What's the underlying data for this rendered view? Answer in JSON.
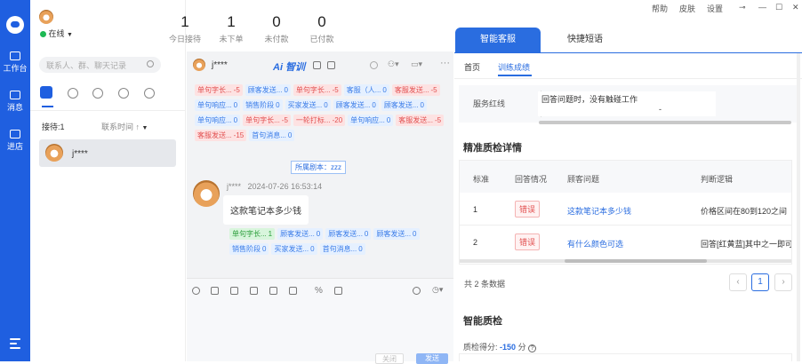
{
  "rail": {
    "items": [
      {
        "label": "工作台"
      },
      {
        "label": "消息"
      },
      {
        "label": "进店"
      }
    ]
  },
  "contacts": {
    "status": "在线",
    "search_placeholder": "联系人、群、聊天记录",
    "reception_count": "接待:1",
    "sort_label": "联系时间",
    "items": [
      {
        "name": "j****"
      }
    ]
  },
  "stats": [
    {
      "value": "1",
      "label": "今日接待"
    },
    {
      "value": "1",
      "label": "未下单"
    },
    {
      "value": "0",
      "label": "未付款"
    },
    {
      "value": "0",
      "label": "已付款"
    }
  ],
  "chat": {
    "customer": "j****",
    "brand": "Ai 智训",
    "tag_rows": [
      [
        {
          "t": "单句字长...",
          "v": "-5",
          "c": "red"
        },
        {
          "t": "顾客发送...",
          "v": "0",
          "c": "blue"
        },
        {
          "t": "单句字长...",
          "v": "-5",
          "c": "red"
        },
        {
          "t": "客服（人...",
          "v": "0",
          "c": "blue"
        },
        {
          "t": "客服发送...",
          "v": "-5",
          "c": "red"
        }
      ],
      [
        {
          "t": "单句响应...",
          "v": "0",
          "c": "blue"
        },
        {
          "t": "销售阶段",
          "v": "0",
          "c": "blue"
        },
        {
          "t": "买家发送...",
          "v": "0",
          "c": "blue"
        },
        {
          "t": "顾客发送...",
          "v": "0",
          "c": "blue"
        },
        {
          "t": "顾客发送...",
          "v": "0",
          "c": "blue"
        }
      ],
      [
        {
          "t": "单句响应...",
          "v": "0",
          "c": "blue"
        },
        {
          "t": "单句字长...",
          "v": "-5",
          "c": "red"
        },
        {
          "t": "一轮打标...",
          "v": "-20",
          "c": "red"
        },
        {
          "t": "单句响应...",
          "v": "0",
          "c": "blue"
        },
        {
          "t": "客服发送...",
          "v": "-5",
          "c": "red"
        }
      ],
      [
        {
          "t": "客服发送...",
          "v": "-15",
          "c": "red"
        },
        {
          "t": "首句消息...",
          "v": "0",
          "c": "blue"
        }
      ]
    ],
    "script_note": "所属剧本：zzz",
    "message": {
      "sender": "j****",
      "time": "2024-07-26 16:53:14",
      "text": "这款笔记本多少钱"
    },
    "msg_tag_rows": [
      [
        {
          "t": "单句字长...",
          "v": "1",
          "c": "green"
        },
        {
          "t": "顾客发送...",
          "v": "0",
          "c": "blue"
        },
        {
          "t": "顾客发送...",
          "v": "0",
          "c": "blue"
        },
        {
          "t": "顾客发送...",
          "v": "0",
          "c": "blue"
        }
      ],
      [
        {
          "t": "销售阶段",
          "v": "0",
          "c": "blue"
        },
        {
          "t": "买家发送...",
          "v": "0",
          "c": "blue"
        },
        {
          "t": "首句消息...",
          "v": "0",
          "c": "blue"
        }
      ]
    ],
    "close_label": "关闭",
    "send_label": "发送"
  },
  "window": {
    "help": "帮助",
    "skin": "皮肤",
    "settings": "设置"
  },
  "right": {
    "tabs": [
      {
        "label": "智能客服"
      },
      {
        "label": "快捷短语"
      }
    ],
    "subtabs": [
      {
        "label": "首页"
      },
      {
        "label": "训练成绩"
      }
    ],
    "service_redline": {
      "label": "服务红线",
      "text": "回答问题时，没有触碰工作",
      "dash": "-"
    },
    "detail_title": "精准质检详情",
    "table": {
      "headers": [
        "标准",
        "回答情况",
        "顾客问题",
        "判断逻辑"
      ],
      "rows": [
        {
          "idx": "1",
          "status": "错误",
          "question": "这款笔记本多少钱",
          "logic": "价格区间在80到120之间"
        },
        {
          "idx": "2",
          "status": "错误",
          "question": "有什么颜色可选",
          "logic": "回答[红黄蓝]其中之一即可"
        }
      ]
    },
    "total": "共 2 条数据",
    "page": "1",
    "smart_title": "智能质检",
    "score_label": "质检得分:",
    "score_value": "-150",
    "score_unit": "分"
  }
}
